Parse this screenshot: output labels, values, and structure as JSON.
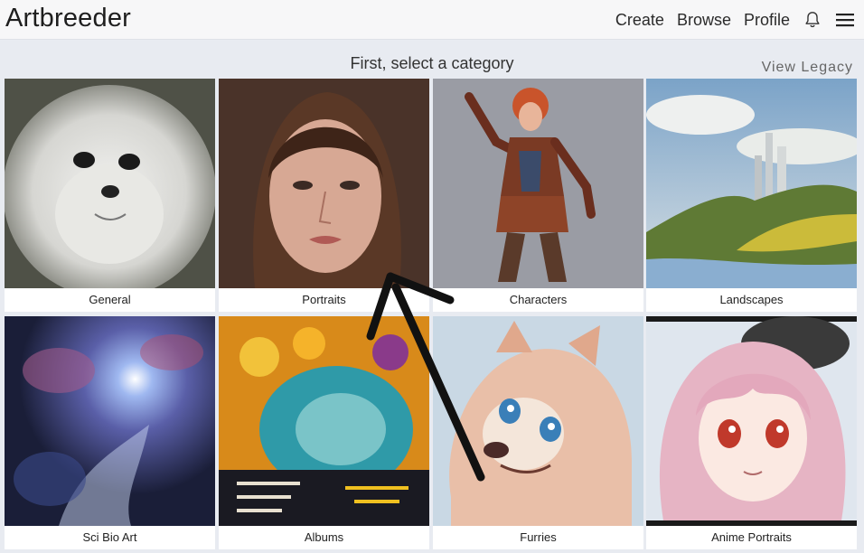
{
  "navbar": {
    "brand": "Artbreeder",
    "links": [
      "Create",
      "Browse",
      "Profile"
    ],
    "bell_icon": "bell-icon",
    "menu_icon": "hamburger-menu-icon"
  },
  "header": {
    "subtitle": "First, select a category",
    "legacy_link": "View Legacy"
  },
  "categories": [
    {
      "label": "General",
      "image": "fluffy-dog-image"
    },
    {
      "label": "Portraits",
      "image": "portrait-woman-image"
    },
    {
      "label": "Characters",
      "image": "warrior-character-image"
    },
    {
      "label": "Landscapes",
      "image": "castle-landscape-image"
    },
    {
      "label": "Sci Bio Art",
      "image": "nebula-image"
    },
    {
      "label": "Albums",
      "image": "album-cover-image"
    },
    {
      "label": "Furries",
      "image": "furry-creature-image"
    },
    {
      "label": "Anime Portraits",
      "image": "anime-girl-image"
    }
  ],
  "annotation": {
    "arrow": "pointer-arrow-icon"
  }
}
